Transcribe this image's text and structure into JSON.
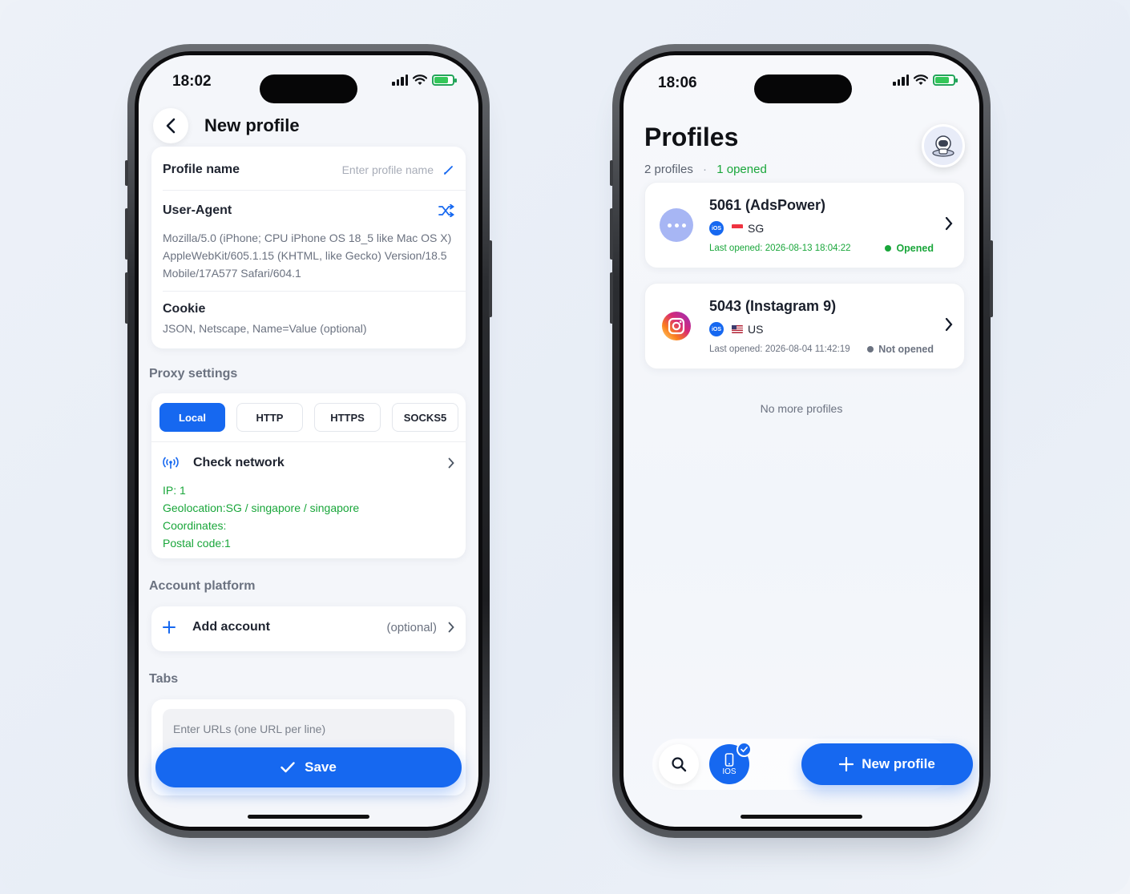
{
  "colors": {
    "accent": "#1668f0",
    "success": "#19a63a",
    "muted": "#a8adb8"
  },
  "left": {
    "status": {
      "time": "18:02"
    },
    "nav": {
      "title": "New profile",
      "back_icon": "chevron-left-icon"
    },
    "profile_name": {
      "label": "Profile name",
      "placeholder": "Enter profile name",
      "icon": "pencil-icon"
    },
    "user_agent": {
      "label": "User-Agent",
      "icon": "shuffle-icon",
      "value": "Mozilla/5.0 (iPhone; CPU iPhone OS 18_5 like Mac OS X) AppleWebKit/605.1.15 (KHTML, like Gecko) Version/18.5 Mobile/17A577 Safari/604.1"
    },
    "cookie": {
      "label": "Cookie",
      "placeholder": "JSON, Netscape, Name=Value (optional)"
    },
    "proxy": {
      "title": "Proxy settings",
      "types": [
        "Local",
        "HTTP",
        "HTTPS",
        "SOCKS5"
      ],
      "selected": "Local",
      "check_network": "Check network",
      "ip": "IP: 1",
      "geolocation": "Geolocation:SG / singapore / singapore",
      "coordinates": "Coordinates:",
      "postal": "Postal code:1"
    },
    "account": {
      "title": "Account platform",
      "add_label": "Add account",
      "optional": "(optional)"
    },
    "tabs": {
      "title": "Tabs",
      "placeholder": "Enter URLs (one URL per line)"
    },
    "save_label": "Save"
  },
  "right": {
    "status": {
      "time": "18:06"
    },
    "title": "Profiles",
    "count_text": "2 profiles",
    "separator": "·",
    "opened_text": "1 opened",
    "profiles": [
      {
        "name": "5061 (AdsPower)",
        "os": "iOS",
        "region": "SG",
        "last_opened": "Last opened: 2026-08-13 18:04:22",
        "state": "Opened",
        "state_color": "#19a63a"
      },
      {
        "name": "5043 (Instagram 9)",
        "os": "iOS",
        "region": "US",
        "last_opened": "Last opened: 2026-08-04 11:42:19",
        "state": "Not opened",
        "state_color": "#6b7280"
      }
    ],
    "no_more": "No more profiles",
    "ios_filter_label": "IOS",
    "new_profile_label": "New profile"
  }
}
